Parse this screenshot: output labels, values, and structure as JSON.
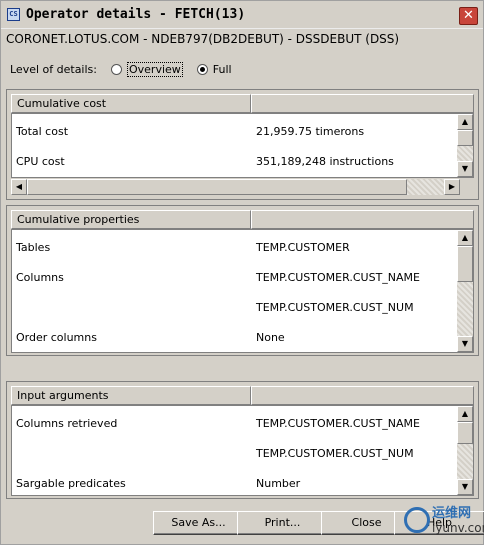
{
  "window": {
    "title": "Operator details - FETCH(13)",
    "app_icon_text": "CS",
    "subtitle": "CORONET.LOTUS.COM - NDEB797(DB2DEBUT) - DSSDEBUT (DSS)"
  },
  "level": {
    "label": "Level of details:",
    "options": [
      "Overview",
      "Full"
    ],
    "selected": "Full"
  },
  "panels": {
    "cost": {
      "header": "Cumulative cost",
      "rows": [
        {
          "label": "Total cost",
          "value": "21,959.75 timerons"
        },
        {
          "label": "CPU cost",
          "value": "351,189,248 instructions"
        }
      ]
    },
    "properties": {
      "header": "Cumulative properties",
      "rows": [
        {
          "label": "Tables",
          "value": "TEMP.CUSTOMER"
        },
        {
          "label": "Columns",
          "value": "TEMP.CUSTOMER.CUST_NAME"
        },
        {
          "label": "",
          "value": "TEMP.CUSTOMER.CUST_NUM"
        },
        {
          "label": "Order columns",
          "value": "None"
        }
      ]
    },
    "arguments": {
      "header": "Input arguments",
      "rows": [
        {
          "label": "Columns retrieved",
          "value": "TEMP.CUSTOMER.CUST_NAME"
        },
        {
          "label": "",
          "value": "TEMP.CUSTOMER.CUST_NUM"
        },
        {
          "label": "Sargable predicates",
          "value": "Number"
        }
      ]
    }
  },
  "buttons": {
    "save": "Save As...",
    "print": "Print...",
    "close": "Close",
    "help": "Help"
  },
  "watermark": {
    "line1": "运维网",
    "line2": "iyunv.com"
  },
  "icons": {
    "close": "close-icon",
    "scroll_up": "scroll-up-arrow-icon",
    "scroll_down": "scroll-down-arrow-icon",
    "scroll_left": "scroll-left-arrow-icon",
    "scroll_right": "scroll-right-arrow-icon"
  }
}
